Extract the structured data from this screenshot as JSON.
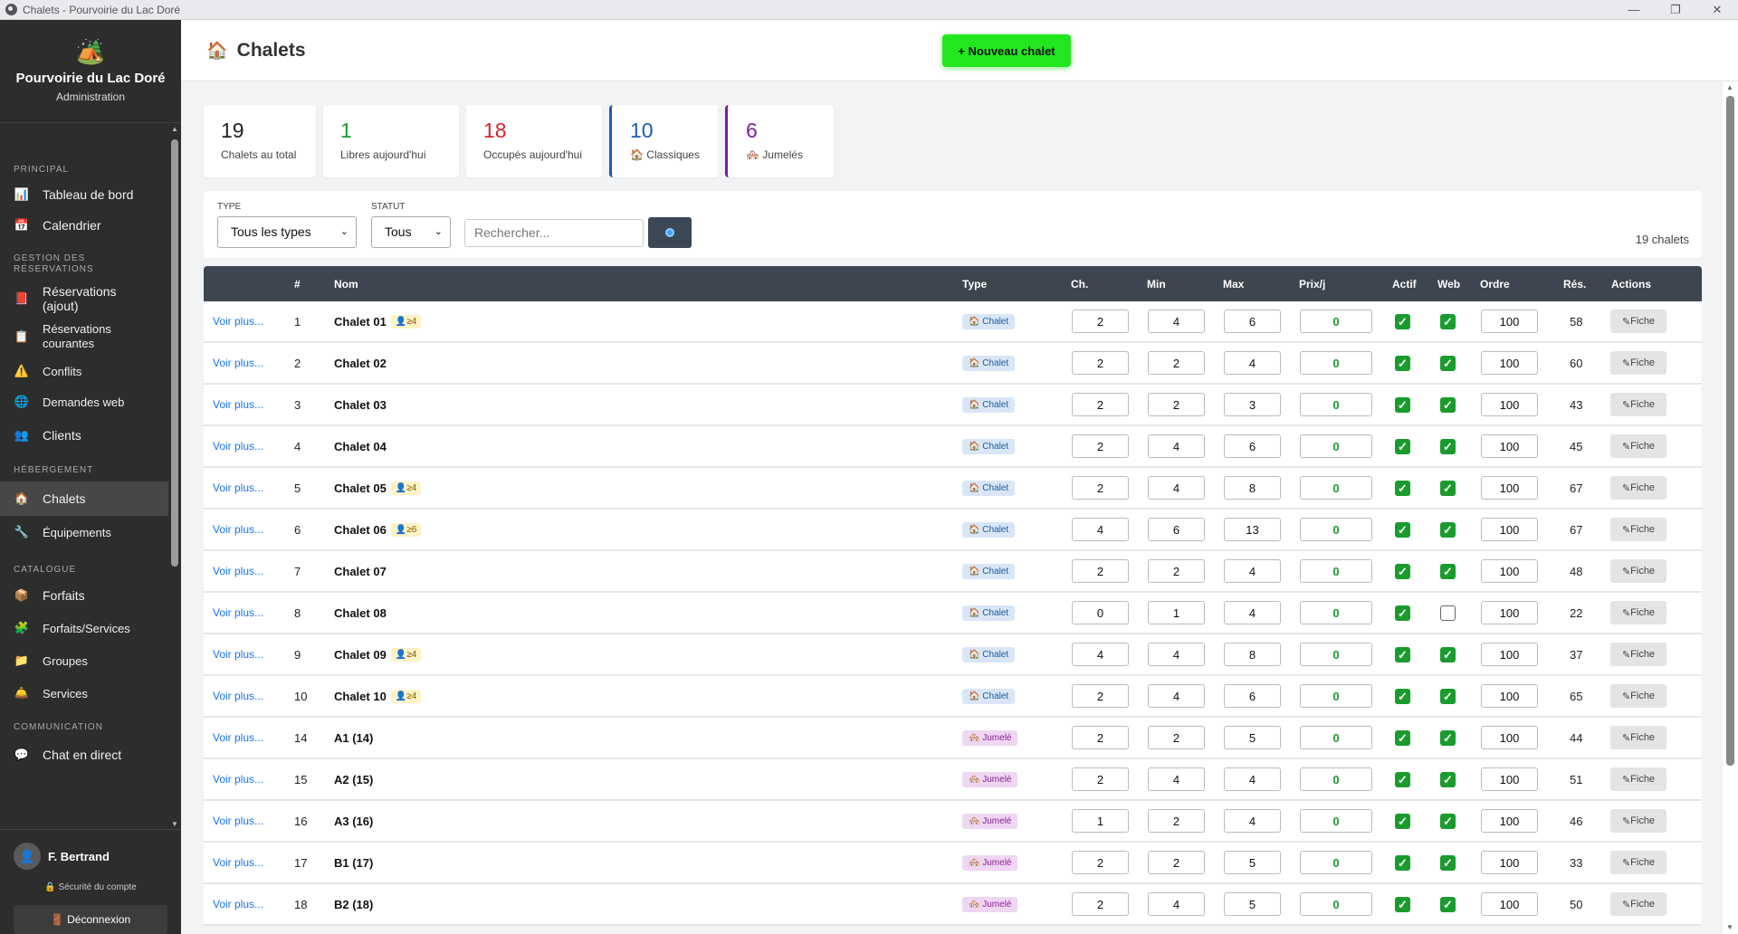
{
  "window": {
    "title": "Chalets - Pourvoirie du Lac Doré"
  },
  "brand": {
    "name": "Pourvoirie du Lac Doré",
    "sub": "Administration"
  },
  "nav": {
    "principal": "PRINCIPAL",
    "tableau": "Tableau de bord",
    "calendrier": "Calendrier",
    "gestion": "GESTION DES RÉSERVATIONS",
    "reservations_ajout": "Réservations (ajout)",
    "reservations_courantes": "Réservations courantes",
    "conflits": "Conflits",
    "demandes": "Demandes web",
    "clients": "Clients",
    "hebergement": "HÉBERGEMENT",
    "chalets": "Chalets",
    "equipements": "Équipements",
    "catalogue": "CATALOGUE",
    "forfaits": "Forfaits",
    "forfaits_services": "Forfaits/Services",
    "groupes": "Groupes",
    "services": "Services",
    "communication": "COMMUNICATION",
    "chat": "Chat en direct"
  },
  "user": {
    "name": "F. Bertrand",
    "security": "Sécurité du compte",
    "logout": "Déconnexion"
  },
  "header": {
    "title": "Chalets",
    "new_button": "+ Nouveau chalet"
  },
  "stats": [
    {
      "num": "19",
      "label": "Chalets au total",
      "color": "#222222"
    },
    {
      "num": "1",
      "label": "Libres aujourd'hui",
      "color": "#1a9b2e"
    },
    {
      "num": "18",
      "label": "Occupés aujourd'hui",
      "color": "#d9232e"
    },
    {
      "num": "10",
      "label": "Classiques",
      "color": "#1d5bb5"
    },
    {
      "num": "6",
      "label": "Jumelés",
      "color": "#7a1f9a"
    }
  ],
  "filters": {
    "type_label": "TYPE",
    "type_value": "Tous les types",
    "statut_label": "STATUT",
    "statut_value": "Tous",
    "search_placeholder": "Rechercher...",
    "count": "19 chalets"
  },
  "table": {
    "headers": {
      "num": "#",
      "nom": "Nom",
      "type": "Type",
      "ch": "Ch.",
      "min": "Min",
      "max": "Max",
      "prix": "Prix/j",
      "actif": "Actif",
      "web": "Web",
      "ordre": "Ordre",
      "res": "Rés.",
      "actions": "Actions"
    },
    "link_label": "Voir plus...",
    "fiche_label": "Fiche",
    "rows": [
      {
        "num": "1",
        "nom": "Chalet 01",
        "badge": "≥4",
        "type": "Chalet",
        "ch": "2",
        "min": "4",
        "max": "6",
        "prix": "0",
        "actif": true,
        "web": true,
        "ordre": "100",
        "res": "58"
      },
      {
        "num": "2",
        "nom": "Chalet 02",
        "badge": "",
        "type": "Chalet",
        "ch": "2",
        "min": "2",
        "max": "4",
        "prix": "0",
        "actif": true,
        "web": true,
        "ordre": "100",
        "res": "60"
      },
      {
        "num": "3",
        "nom": "Chalet 03",
        "badge": "",
        "type": "Chalet",
        "ch": "2",
        "min": "2",
        "max": "3",
        "prix": "0",
        "actif": true,
        "web": true,
        "ordre": "100",
        "res": "43"
      },
      {
        "num": "4",
        "nom": "Chalet 04",
        "badge": "",
        "type": "Chalet",
        "ch": "2",
        "min": "4",
        "max": "6",
        "prix": "0",
        "actif": true,
        "web": true,
        "ordre": "100",
        "res": "45"
      },
      {
        "num": "5",
        "nom": "Chalet 05",
        "badge": "≥4",
        "type": "Chalet",
        "ch": "2",
        "min": "4",
        "max": "8",
        "prix": "0",
        "actif": true,
        "web": true,
        "ordre": "100",
        "res": "67"
      },
      {
        "num": "6",
        "nom": "Chalet 06",
        "badge": "≥6",
        "type": "Chalet",
        "ch": "4",
        "min": "6",
        "max": "13",
        "prix": "0",
        "actif": true,
        "web": true,
        "ordre": "100",
        "res": "67"
      },
      {
        "num": "7",
        "nom": "Chalet 07",
        "badge": "",
        "type": "Chalet",
        "ch": "2",
        "min": "2",
        "max": "4",
        "prix": "0",
        "actif": true,
        "web": true,
        "ordre": "100",
        "res": "48"
      },
      {
        "num": "8",
        "nom": "Chalet 08",
        "badge": "",
        "type": "Chalet",
        "ch": "0",
        "min": "1",
        "max": "4",
        "prix": "0",
        "actif": true,
        "web": false,
        "ordre": "100",
        "res": "22"
      },
      {
        "num": "9",
        "nom": "Chalet 09",
        "badge": "≥4",
        "type": "Chalet",
        "ch": "4",
        "min": "4",
        "max": "8",
        "prix": "0",
        "actif": true,
        "web": true,
        "ordre": "100",
        "res": "37"
      },
      {
        "num": "10",
        "nom": "Chalet 10",
        "badge": "≥4",
        "type": "Chalet",
        "ch": "2",
        "min": "4",
        "max": "6",
        "prix": "0",
        "actif": true,
        "web": true,
        "ordre": "100",
        "res": "65"
      },
      {
        "num": "14",
        "nom": "A1 (14)",
        "badge": "",
        "type": "Jumelé",
        "ch": "2",
        "min": "2",
        "max": "5",
        "prix": "0",
        "actif": true,
        "web": true,
        "ordre": "100",
        "res": "44"
      },
      {
        "num": "15",
        "nom": "A2 (15)",
        "badge": "",
        "type": "Jumelé",
        "ch": "2",
        "min": "4",
        "max": "4",
        "prix": "0",
        "actif": true,
        "web": true,
        "ordre": "100",
        "res": "51"
      },
      {
        "num": "16",
        "nom": "A3 (16)",
        "badge": "",
        "type": "Jumelé",
        "ch": "1",
        "min": "2",
        "max": "4",
        "prix": "0",
        "actif": true,
        "web": true,
        "ordre": "100",
        "res": "46"
      },
      {
        "num": "17",
        "nom": "B1 (17)",
        "badge": "",
        "type": "Jumelé",
        "ch": "2",
        "min": "2",
        "max": "5",
        "prix": "0",
        "actif": true,
        "web": true,
        "ordre": "100",
        "res": "33"
      },
      {
        "num": "18",
        "nom": "B2 (18)",
        "badge": "",
        "type": "Jumelé",
        "ch": "2",
        "min": "4",
        "max": "5",
        "prix": "0",
        "actif": true,
        "web": true,
        "ordre": "100",
        "res": "50"
      }
    ]
  }
}
